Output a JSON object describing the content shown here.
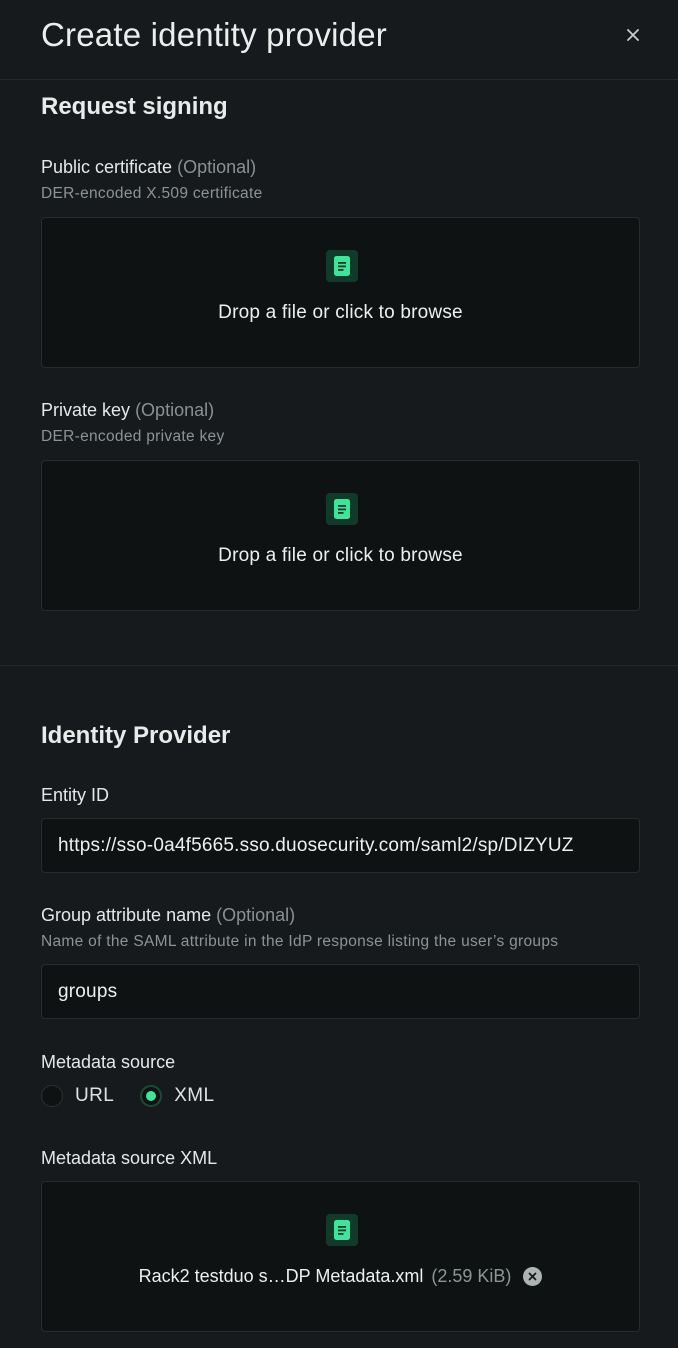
{
  "dialog": {
    "title": "Create identity provider",
    "close_label": "×"
  },
  "request_signing": {
    "section_title": "Request signing",
    "public_certificate": {
      "label": "Public certificate",
      "optional": "(Optional)",
      "hint": "DER-encoded X.509 certificate",
      "dropzone_text": "Drop a file or click to browse"
    },
    "private_key": {
      "label": "Private key",
      "optional": "(Optional)",
      "hint": "DER-encoded private key",
      "dropzone_text": "Drop a file or click to browse"
    }
  },
  "identity_provider": {
    "section_title": "Identity Provider",
    "entity_id": {
      "label": "Entity ID",
      "value": "https://sso-0a4f5665.sso.duosecurity.com/saml2/sp/DIZYUZ"
    },
    "group_attribute": {
      "label": "Group attribute name",
      "optional": "(Optional)",
      "hint": "Name of the SAML attribute in the IdP response listing the user’s groups",
      "value": "groups"
    },
    "metadata_source": {
      "label": "Metadata source",
      "options": [
        "URL",
        "XML"
      ],
      "selected": "XML"
    },
    "metadata_xml": {
      "label": "Metadata source XML",
      "file_name": "Rack2 testduo s…DP Metadata.xml",
      "file_size": "(2.59 KiB)"
    }
  },
  "colors": {
    "background": "#161a1c",
    "input_background": "#0f1213",
    "accent": "#3fe39a",
    "icon_tile": "#123a2b"
  },
  "icons": {
    "close": "close-icon",
    "file": "file-icon",
    "remove": "remove-file-icon"
  }
}
